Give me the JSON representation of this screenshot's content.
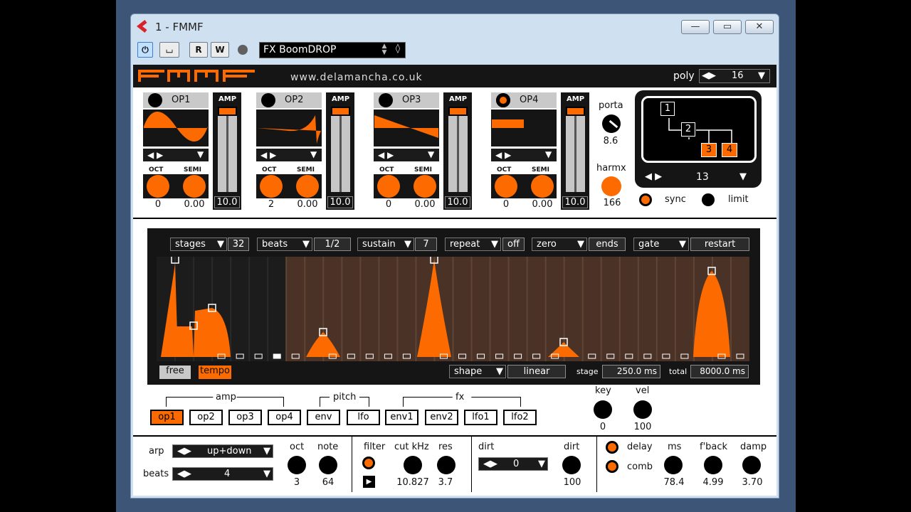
{
  "window": {
    "title": "1 - FMMF",
    "preset": "FX BoomDROP"
  },
  "header": {
    "logo": "FMMF",
    "url": "www.delamancha.co.uk",
    "poly_label": "poly",
    "poly_value": "16"
  },
  "operators": [
    {
      "name": "OP1",
      "oct": "0",
      "semi": "0.00",
      "amp": "10.0"
    },
    {
      "name": "OP2",
      "oct": "2",
      "semi": "0.00",
      "amp": "10.0"
    },
    {
      "name": "OP3",
      "oct": "0",
      "semi": "0.00",
      "amp": "10.0"
    },
    {
      "name": "OP4",
      "oct": "0",
      "semi": "0.00",
      "amp": "10.0"
    }
  ],
  "op_labels": {
    "amp": "AMP",
    "oct": "OCT",
    "semi": "SEMI"
  },
  "porta": {
    "label": "porta",
    "value": "8.6"
  },
  "harmx": {
    "label": "harmx",
    "value": "166"
  },
  "algorithm": {
    "value": "13",
    "boxes": [
      "1",
      "2",
      "3",
      "4"
    ],
    "sync": "sync",
    "limit": "limit"
  },
  "sequencer": {
    "stages_label": "stages",
    "stages": "32",
    "beats_label": "beats",
    "beats": "1/2",
    "sustain_label": "sustain",
    "sustain": "7",
    "repeat_label": "repeat",
    "repeat": "off",
    "zero_label": "zero",
    "zero": "ends",
    "gate_label": "gate",
    "gate": "restart",
    "free": "free",
    "tempo": "tempo",
    "shape_label": "shape",
    "shape": "linear",
    "stage_label": "stage",
    "stage_value": "250.0 ms",
    "total_label": "total",
    "total_value": "8000.0 ms"
  },
  "targets": {
    "amp": "amp",
    "pitch": "pitch",
    "fx": "fx",
    "buttons": [
      "op1",
      "op2",
      "op3",
      "op4",
      "env",
      "lfo",
      "env1",
      "env2",
      "lfo1",
      "lfo2"
    ]
  },
  "keyvel": {
    "key_label": "key",
    "key": "0",
    "vel_label": "vel",
    "vel": "100"
  },
  "bottom": {
    "arp_label": "arp",
    "arp_mode": "up+down",
    "beats_label": "beats",
    "beats_value": "4",
    "oct_label": "oct",
    "oct": "3",
    "note_label": "note",
    "note": "64",
    "filter_label": "filter",
    "cut_label": "cut kHz",
    "cut": "10.827",
    "res_label": "res",
    "res": "3.7",
    "dirt_label": "dirt",
    "dirt_mode": "0",
    "dirt2_label": "dirt",
    "dirt": "100",
    "delay_label": "delay",
    "comb_label": "comb",
    "ms_label": "ms",
    "ms": "78.4",
    "fback_label": "f'back",
    "fback": "4.99",
    "damp_label": "damp",
    "damp": "3.70"
  },
  "colors": {
    "accent": "#fc6a00",
    "dark": "#151515",
    "seq_bg": "#4a3326"
  },
  "chart_data": {
    "type": "area",
    "title": "",
    "stages": 32,
    "sustain_stage": 7
  }
}
